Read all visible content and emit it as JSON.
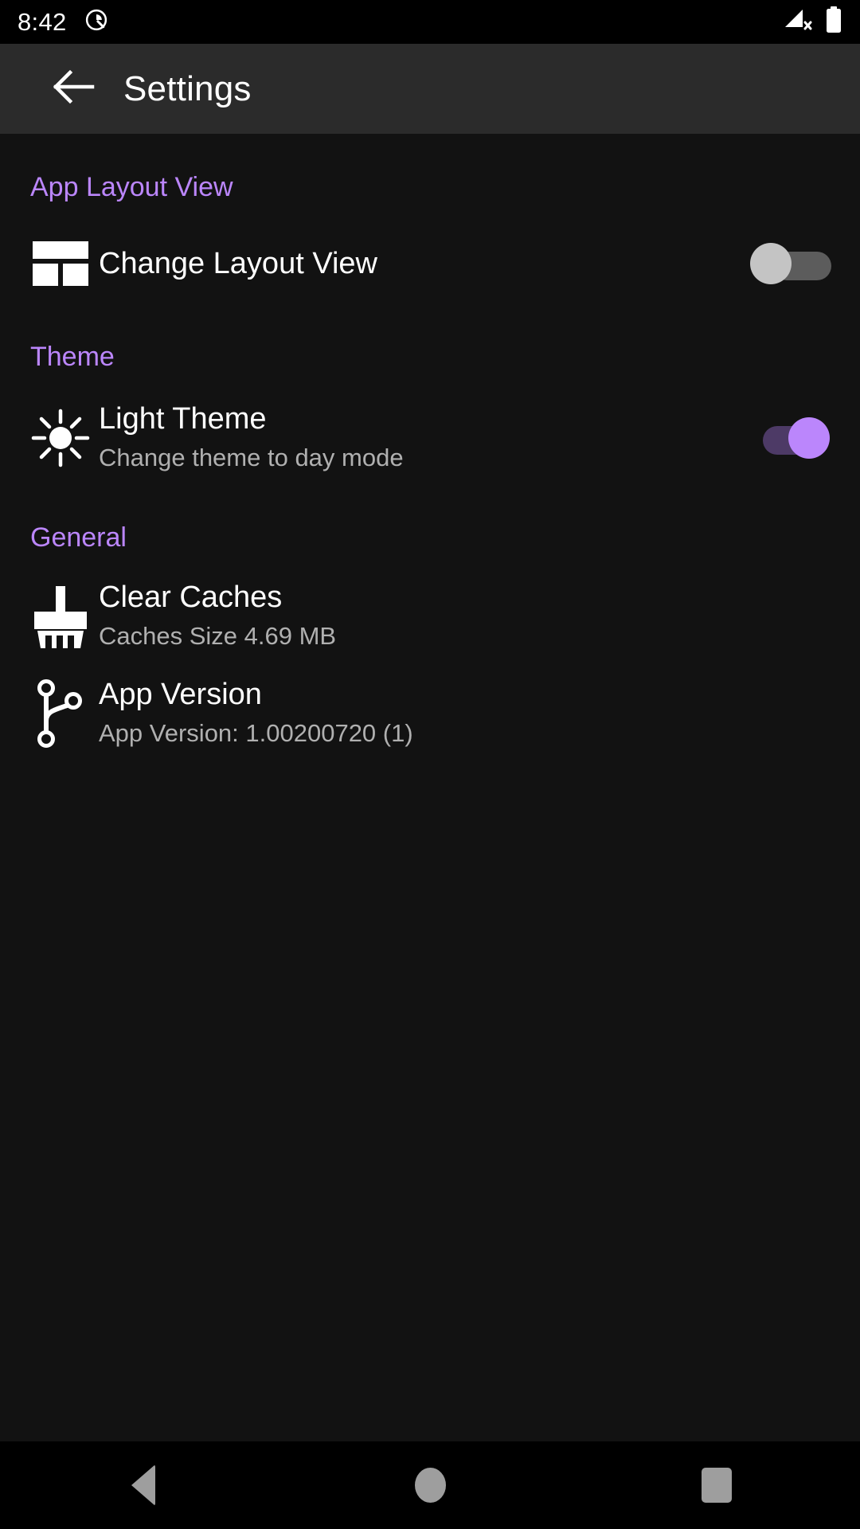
{
  "statusbar": {
    "time": "8:42",
    "icons": [
      "android-q-logo-icon",
      "signal-no-sim-icon",
      "battery-full-icon"
    ]
  },
  "appbar": {
    "back_icon": "arrow-left-icon",
    "title": "Settings"
  },
  "accent_color": "#bb86fc",
  "background_color": "#121212",
  "appbar_color": "#2b2b2b",
  "sections": [
    {
      "header": "App Layout View",
      "rows": [
        {
          "icon": "layout-grid-icon",
          "title": "Change Layout View",
          "subtitle": "",
          "control": "switch",
          "switch_state": "off"
        }
      ]
    },
    {
      "header": "Theme",
      "rows": [
        {
          "icon": "sun-icon",
          "title": "Light Theme",
          "subtitle": "Change theme to day mode",
          "control": "switch",
          "switch_state": "on"
        }
      ]
    },
    {
      "header": "General",
      "rows": [
        {
          "icon": "brush-icon",
          "title": "Clear Caches",
          "subtitle": "Caches Size 4.69 MB",
          "control": "none"
        },
        {
          "icon": "git-branch-icon",
          "title": "App Version",
          "subtitle": "App Version: 1.00200720 (1)",
          "control": "none"
        }
      ]
    }
  ],
  "navbar": {
    "back_label": "Back",
    "home_label": "Home",
    "recents_label": "Recents"
  }
}
